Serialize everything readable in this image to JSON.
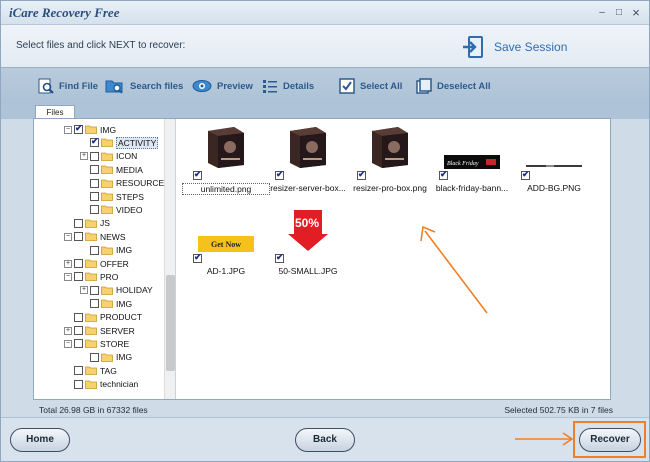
{
  "window": {
    "title": "iCare Recovery Free",
    "minimize_glyph": "–",
    "maximize_glyph": "□",
    "close_glyph": "×"
  },
  "header": {
    "instruction": "Select files and click NEXT to recover:",
    "save_session_label": "Save Session"
  },
  "toolbar": {
    "find_file": "Find File",
    "search_files": "Search files",
    "preview": "Preview",
    "details": "Details",
    "select_all": "Select All",
    "deselect_all": "Deselect All"
  },
  "tabs": {
    "files": "Files"
  },
  "tree": {
    "nodes": [
      {
        "label": "IMG",
        "expander": "−",
        "checked": true
      },
      {
        "label": "ACTIVITY",
        "expander": "",
        "checked": true,
        "selected": true
      },
      {
        "label": "ICON",
        "expander": "+",
        "checked": false
      },
      {
        "label": "MEDIA",
        "expander": "",
        "checked": false
      },
      {
        "label": "RESOURCE",
        "expander": "",
        "checked": false
      },
      {
        "label": "STEPS",
        "expander": "",
        "checked": false
      },
      {
        "label": "VIDEO",
        "expander": "",
        "checked": false
      },
      {
        "label": "JS",
        "expander": "",
        "checked": false
      },
      {
        "label": "NEWS",
        "expander": "−",
        "checked": false
      },
      {
        "label": "IMG",
        "expander": "",
        "checked": false
      },
      {
        "label": "OFFER",
        "expander": "+",
        "checked": false
      },
      {
        "label": "PRO",
        "expander": "−",
        "checked": false
      },
      {
        "label": "HOLIDAY",
        "expander": "+",
        "checked": false
      },
      {
        "label": "IMG",
        "expander": "",
        "checked": false
      },
      {
        "label": "PRODUCT",
        "expander": "",
        "checked": false
      },
      {
        "label": "SERVER",
        "expander": "+",
        "checked": false
      },
      {
        "label": "STORE",
        "expander": "−",
        "checked": false
      },
      {
        "label": "IMG",
        "expander": "",
        "checked": false
      },
      {
        "label": "TAG",
        "expander": "",
        "checked": false
      },
      {
        "label": "technician",
        "expander": "",
        "checked": false
      }
    ]
  },
  "files": [
    {
      "name": "unlimited.png",
      "checked": true,
      "thumb": "dark-box",
      "selected": true
    },
    {
      "name": "resizer-server-box...",
      "checked": true,
      "thumb": "dark-box"
    },
    {
      "name": "resizer-pro-box.png",
      "checked": true,
      "thumb": "dark-box"
    },
    {
      "name": "black-friday-bann...",
      "checked": true,
      "thumb": "black-banner",
      "thumb_text": "Black Friday"
    },
    {
      "name": "ADD-BG.PNG",
      "checked": true,
      "thumb": "thin-line"
    },
    {
      "name": "AD-1.JPG",
      "checked": true,
      "thumb": "get-now",
      "thumb_text": "Get Now"
    },
    {
      "name": "50-SMALL.JPG",
      "checked": true,
      "thumb": "red-arrow",
      "thumb_text": "50%"
    }
  ],
  "status": {
    "total": "Total 26.98 GB in 67332 files",
    "selected": "Selected 502.75 KB in 7 files"
  },
  "footer": {
    "home": "Home",
    "back": "Back",
    "recover": "Recover"
  },
  "colors": {
    "accent": "#2f6db3",
    "annotation": "#f07f27"
  }
}
